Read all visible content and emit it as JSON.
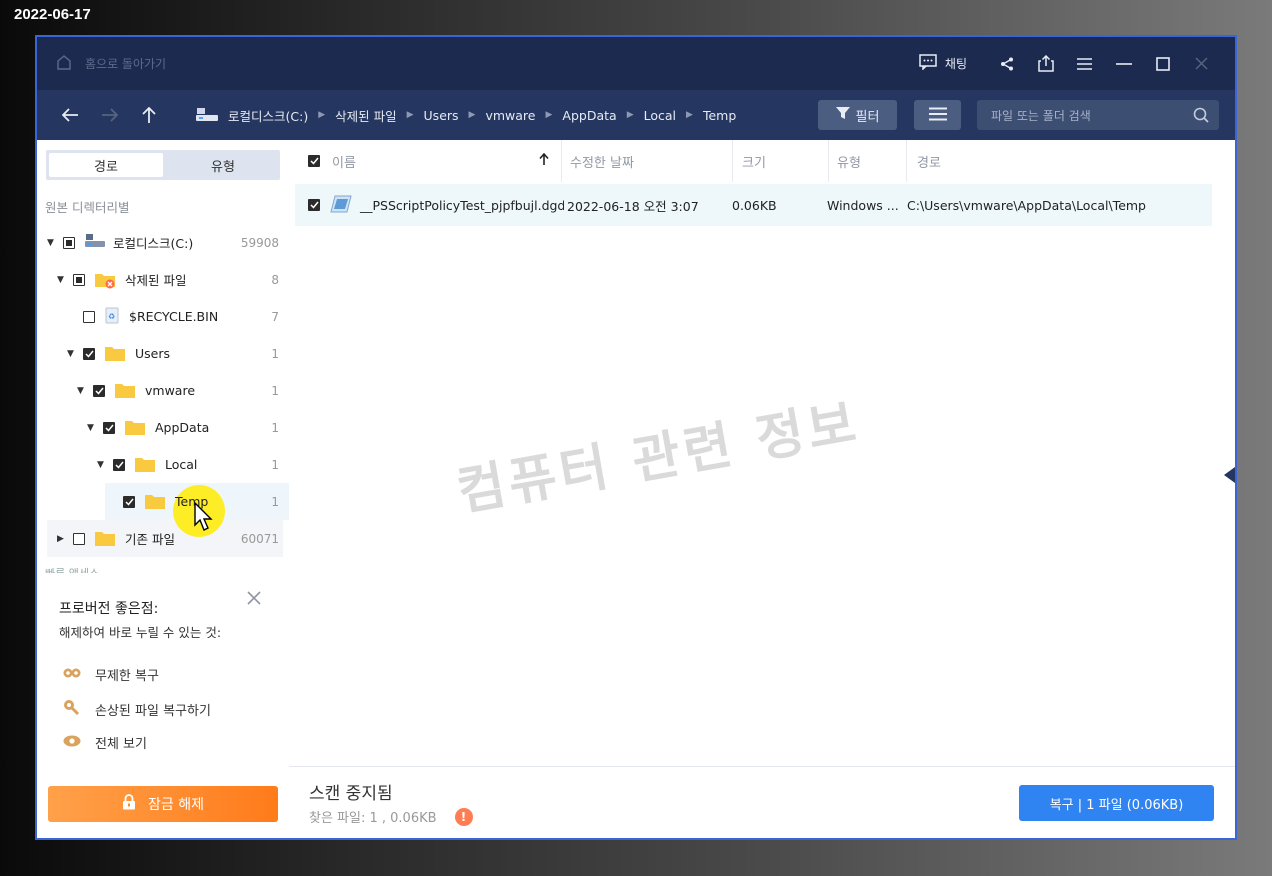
{
  "date_stamp": "2022-06-17",
  "titlebar": {
    "home_label": "홈으로 돌아가기",
    "chat_label": "채팅",
    "icons": [
      "chat-icon",
      "share-icon",
      "export-icon",
      "menu-icon",
      "minimize-icon",
      "maximize-icon",
      "close-icon"
    ]
  },
  "navbar": {
    "breadcrumb": [
      "로컬디스크(C:)",
      "삭제된 파일",
      "Users",
      "vmware",
      "AppData",
      "Local",
      "Temp"
    ],
    "filter_label": "필터",
    "search_placeholder": "파일 또는 폴더 검색"
  },
  "sidebar": {
    "tabs": [
      "경로",
      "유형"
    ],
    "active_tab": "경로",
    "section_label": "원본 디렉터리별",
    "tree": [
      {
        "label": "로컬디스크(C:)",
        "count": "59908",
        "state": "partial",
        "expanded": true
      },
      {
        "label": "삭제된 파일",
        "count": "8",
        "state": "partial",
        "expanded": true
      },
      {
        "label": "$RECYCLE.BIN",
        "count": "7",
        "state": "unchecked"
      },
      {
        "label": "Users",
        "count": "1",
        "state": "checked",
        "expanded": true
      },
      {
        "label": "vmware",
        "count": "1",
        "state": "checked",
        "expanded": true
      },
      {
        "label": "AppData",
        "count": "1",
        "state": "checked",
        "expanded": true
      },
      {
        "label": "Local",
        "count": "1",
        "state": "checked",
        "expanded": true
      },
      {
        "label": "Temp",
        "count": "1",
        "state": "checked",
        "selected": true
      },
      {
        "label": "기존 파일",
        "count": "60071",
        "state": "unchecked",
        "expanded": false
      }
    ],
    "quick_access_label": "빠른 액세스",
    "promo": {
      "title": "프로버전 좋은점:",
      "subtitle": "해제하여 바로 누릴 수 있는 것:",
      "items": [
        "무제한 복구",
        "손상된 파일 복구하기",
        "전체 보기"
      ]
    },
    "unlock_label": "잠금 해제"
  },
  "table": {
    "columns": [
      "이름",
      "수정한 날짜",
      "크기",
      "유형",
      "경로"
    ],
    "rows": [
      {
        "name": "__PSScriptPolicyTest_pjpfbujl.dgd...",
        "modified": "2022-06-18 오전 3:07",
        "size": "0.06KB",
        "type": "Windows ...",
        "path": "C:\\Users\\vmware\\AppData\\Local\\Temp",
        "checked": true
      }
    ]
  },
  "watermark": "컴퓨터 관련 정보",
  "footer": {
    "status": "스캔 중지됨",
    "found": "찾은 파일: 1 , 0.06KB",
    "warning_symbol": "!",
    "recover_label": "복구 | 1 파일 (0.06KB)"
  },
  "colors": {
    "titlebar": "#1b2a4e",
    "navbar": "#253760",
    "accent_blue": "#2f84f2",
    "unlock_orange": "#ff8a2a"
  }
}
